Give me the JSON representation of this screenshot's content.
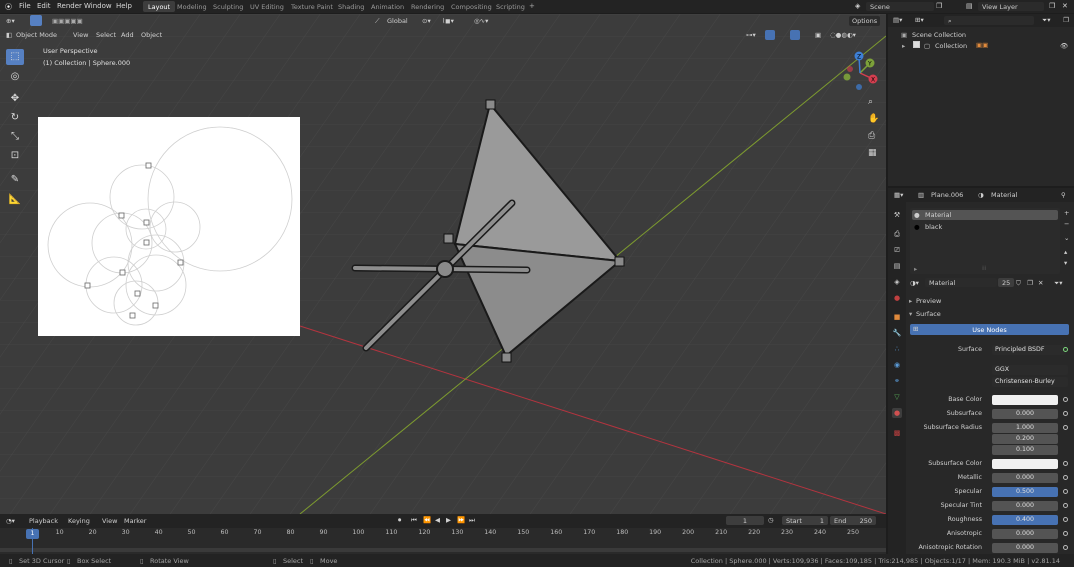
{
  "menus": [
    "File",
    "Edit",
    "Render",
    "Window",
    "Help"
  ],
  "workspaces": [
    "Layout",
    "Modeling",
    "Sculpting",
    "UV Editing",
    "Texture Paint",
    "Shading",
    "Animation",
    "Rendering",
    "Compositing",
    "Scripting"
  ],
  "active_workspace": "Layout",
  "scene_name": "Scene",
  "view_layer": "View Layer",
  "viewport": {
    "mode": "Object Mode",
    "menus": [
      "View",
      "Select",
      "Add",
      "Object"
    ],
    "orientation": "Global",
    "options": "Options",
    "perspective": "User Perspective",
    "collection_info": "(1) Collection | Sphere.000",
    "gizmo": {
      "x": "X",
      "y": "Y",
      "z": "Z"
    },
    "colors": {
      "grid_x": "#b3343f",
      "grid_y": "#7d9b2f",
      "pyramid": "#8f8f8f"
    }
  },
  "outliner": {
    "search_placeholder": "",
    "scene_collection": "Scene Collection",
    "collection": "Collection"
  },
  "properties": {
    "object": "Plane.006",
    "material_tab": "Material",
    "slots": [
      "Material",
      "black"
    ],
    "material_name": "Material",
    "users": "25",
    "preview": "Preview",
    "surface_panel": "Surface",
    "use_nodes": "Use Nodes",
    "surface_label": "Surface",
    "surface_value": "Principled BSDF",
    "distribution": "GGX",
    "subsurface_method": "Christensen-Burley",
    "rows": [
      {
        "label": "Base Color",
        "value": "",
        "kind": "white"
      },
      {
        "label": "Subsurface",
        "value": "0.000",
        "kind": "grey"
      },
      {
        "label": "Subsurface Radius",
        "value": "1.000",
        "kind": "grey"
      },
      {
        "label": "",
        "value": "0.200",
        "kind": "grey"
      },
      {
        "label": "",
        "value": "0.100",
        "kind": "grey"
      },
      {
        "label": "Subsurface Color",
        "value": "",
        "kind": "white"
      },
      {
        "label": "Metallic",
        "value": "0.000",
        "kind": "grey"
      },
      {
        "label": "Specular",
        "value": "0.500",
        "kind": "blue"
      },
      {
        "label": "Specular Tint",
        "value": "0.000",
        "kind": "grey"
      },
      {
        "label": "Roughness",
        "value": "0.400",
        "kind": "blue"
      },
      {
        "label": "Anisotropic",
        "value": "0.000",
        "kind": "grey"
      },
      {
        "label": "Anisotropic Rotation",
        "value": "0.000",
        "kind": "grey"
      }
    ]
  },
  "timeline": {
    "menus": [
      "Playback",
      "Keying",
      "View",
      "Marker"
    ],
    "current_frame": "1",
    "start_label": "Start",
    "start": "1",
    "end_label": "End",
    "end": "250",
    "ticks": [
      "1",
      "10",
      "20",
      "30",
      "40",
      "50",
      "60",
      "70",
      "80",
      "90",
      "100",
      "110",
      "120",
      "130",
      "140",
      "150",
      "160",
      "170",
      "180",
      "190",
      "200",
      "210",
      "220",
      "230",
      "240",
      "250"
    ]
  },
  "statusbar": {
    "left": [
      "Set 3D Cursor",
      "Box Select",
      "Rotate View",
      "Select",
      "Move"
    ],
    "right": "Collection | Sphere.000 | Verts:109,936 | Faces:109,185 | Tris:214,985 | Objects:1/17 | Mem: 190.3 MiB | v2.81.14"
  }
}
